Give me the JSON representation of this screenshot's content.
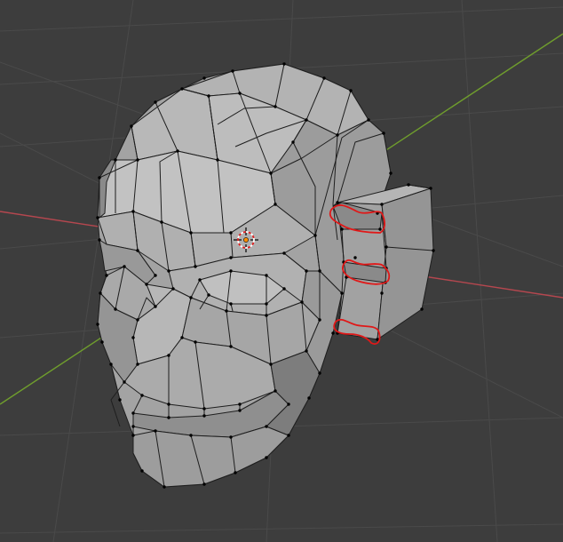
{
  "viewport": {
    "background": "#3d3d3d",
    "grid_color": "#4a4a4a",
    "x_axis_color": "#b5474f",
    "y_axis_color": "#6f9d2d"
  },
  "mesh": {
    "face_color": "#a3a3a3",
    "face_light": "#b4b4b4",
    "face_dark": "#848484",
    "edge_color": "#1e1e1e",
    "vertex_color": "#000000"
  },
  "annotations": {
    "color": "#e01818",
    "count": 3
  },
  "cursor": {
    "icon": "3d-cursor-icon",
    "ring_colors": [
      "#ffffff",
      "#e02020"
    ],
    "origin_color": "#ff8c00"
  }
}
